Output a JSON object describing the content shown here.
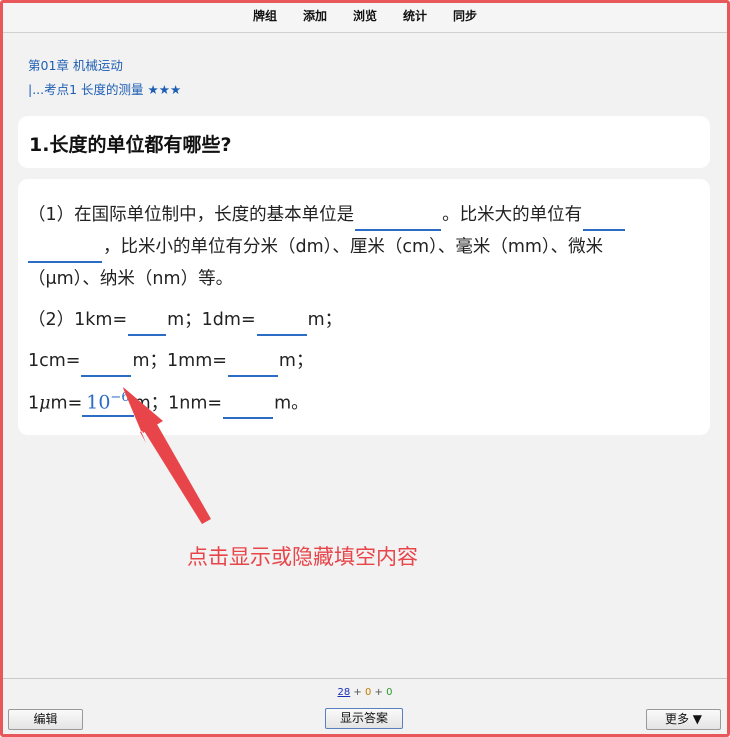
{
  "topbar": {
    "items": [
      "牌组",
      "添加",
      "浏览",
      "统计",
      "同步"
    ]
  },
  "breadcrumb": {
    "chapter": "第01章 机械运动",
    "section": "|...考点1 长度的测量 ★★★"
  },
  "question": {
    "title": "1.长度的单位都有哪些?"
  },
  "body": {
    "p1_a": "（1）在国际单位制中，长度的基本单位是",
    "p1_b": "。比米大的单位有",
    "p1_c": "，比米小的单位有分米（dm）、厘米（cm）、毫米（mm）、微米",
    "p1_d": "（μm）、纳米（nm）等。",
    "p2_a": "（2）1km=",
    "p2_b": "m；1dm=",
    "p2_c": "m；",
    "p3_a": "1cm=",
    "p3_b": "m；1mm=",
    "p3_c": "m；",
    "p4_a": "1",
    "p4_mu": "μ",
    "p4_b": "m=",
    "answer_base": "10",
    "answer_exp": "−6",
    "p4_c": "m；1nm=",
    "p4_d": "m。"
  },
  "annotation": "点击显示或隐藏填空内容",
  "counts": {
    "due": "28",
    "plus1": " + ",
    "learn": "0",
    "plus2": " + ",
    "new": "0"
  },
  "buttons": {
    "edit": "编辑",
    "show_answer": "显示答案",
    "more": "更多 ▼"
  },
  "colors": {
    "accent": "#2b6cc4",
    "frame": "#e8585b",
    "annotation": "#e8454a"
  }
}
